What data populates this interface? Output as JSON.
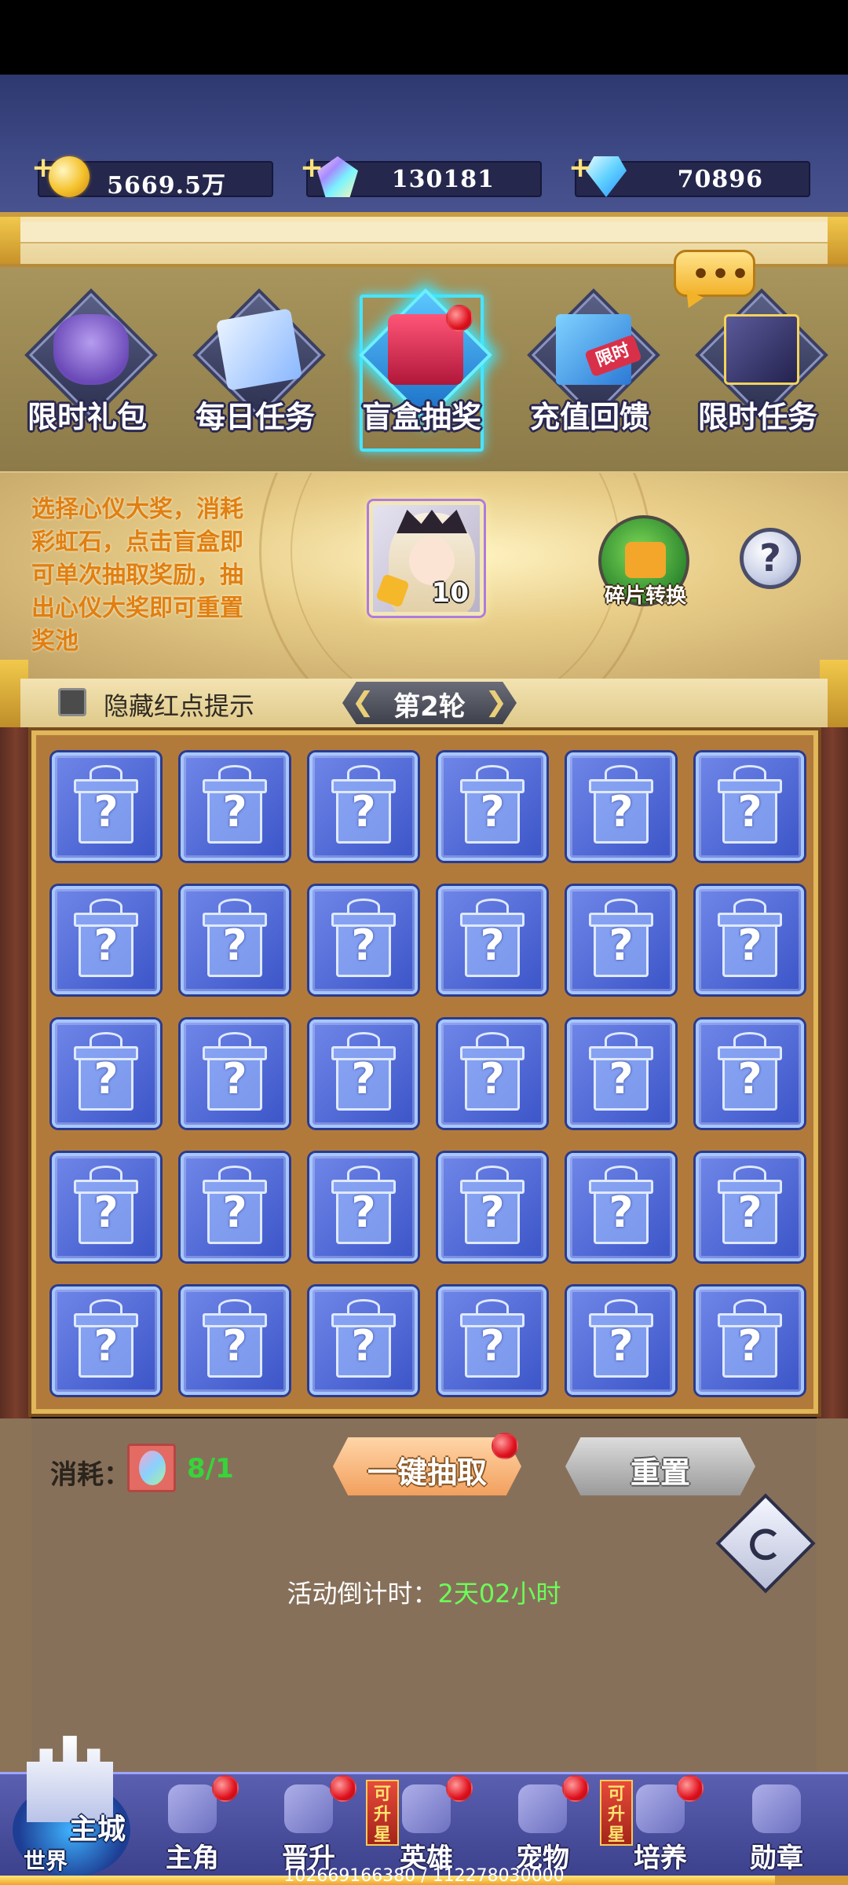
{
  "currencies": [
    {
      "name": "gold",
      "icon": "gold-coin-icon",
      "amount": "5669.5万"
    },
    {
      "name": "rainbow-gem",
      "icon": "rainbow-gem-icon",
      "amount": "130181"
    },
    {
      "name": "blue-diamond",
      "icon": "blue-diamond-icon",
      "amount": "70896"
    }
  ],
  "tabs": [
    {
      "label": "限时礼包",
      "icon": "money-bag-icon",
      "active": false
    },
    {
      "label": "每日任务",
      "icon": "task-document-icon",
      "active": false
    },
    {
      "label": "盲盒抽奖",
      "icon": "blind-box-icon",
      "active": true
    },
    {
      "label": "充值回馈",
      "icon": "gift-box-icon",
      "badge": "限时",
      "active": false
    },
    {
      "label": "限时任务",
      "icon": "magic-book-icon",
      "active": false
    }
  ],
  "info": {
    "description": "选择心仪大奖，消耗彩虹石，点击盲盒即可单次抽取奖励，抽出心仪大奖即可重置奖池",
    "prize_count": "10",
    "convert_label": "碎片转换",
    "help_symbol": "?"
  },
  "round": {
    "hide_red_dot_label": "隐藏红点提示",
    "hide_red_dot_checked": false,
    "label": "第2轮",
    "prev_arrow": "❮",
    "next_arrow": "❯"
  },
  "grid": {
    "rows": 5,
    "cols": 6,
    "cell_symbol": "?"
  },
  "bottom": {
    "cost_label": "消耗：",
    "cost_value": "8/1",
    "draw_all_label": "一键抽取",
    "reset_label": "重置",
    "countdown_label": "活动倒计时：",
    "countdown_value": "2天02小时"
  },
  "nav": {
    "home_main": "主城",
    "home_world": "世界",
    "items": [
      {
        "label": "主角",
        "icon": "hero-icon",
        "red_dot": true
      },
      {
        "label": "晋升",
        "icon": "promotion-icon",
        "red_dot": true
      },
      {
        "label": "英雄",
        "icon": "heroes-icon",
        "red_dot": true,
        "tag": "可升星"
      },
      {
        "label": "宠物",
        "icon": "pet-icon",
        "red_dot": true
      },
      {
        "label": "培养",
        "icon": "train-icon",
        "red_dot": true,
        "tag": "可升星"
      },
      {
        "label": "勋章",
        "icon": "medal-icon",
        "red_dot": false
      }
    ]
  },
  "exp": {
    "text": "102669166380 / 112278030000",
    "fraction": 0.914
  }
}
